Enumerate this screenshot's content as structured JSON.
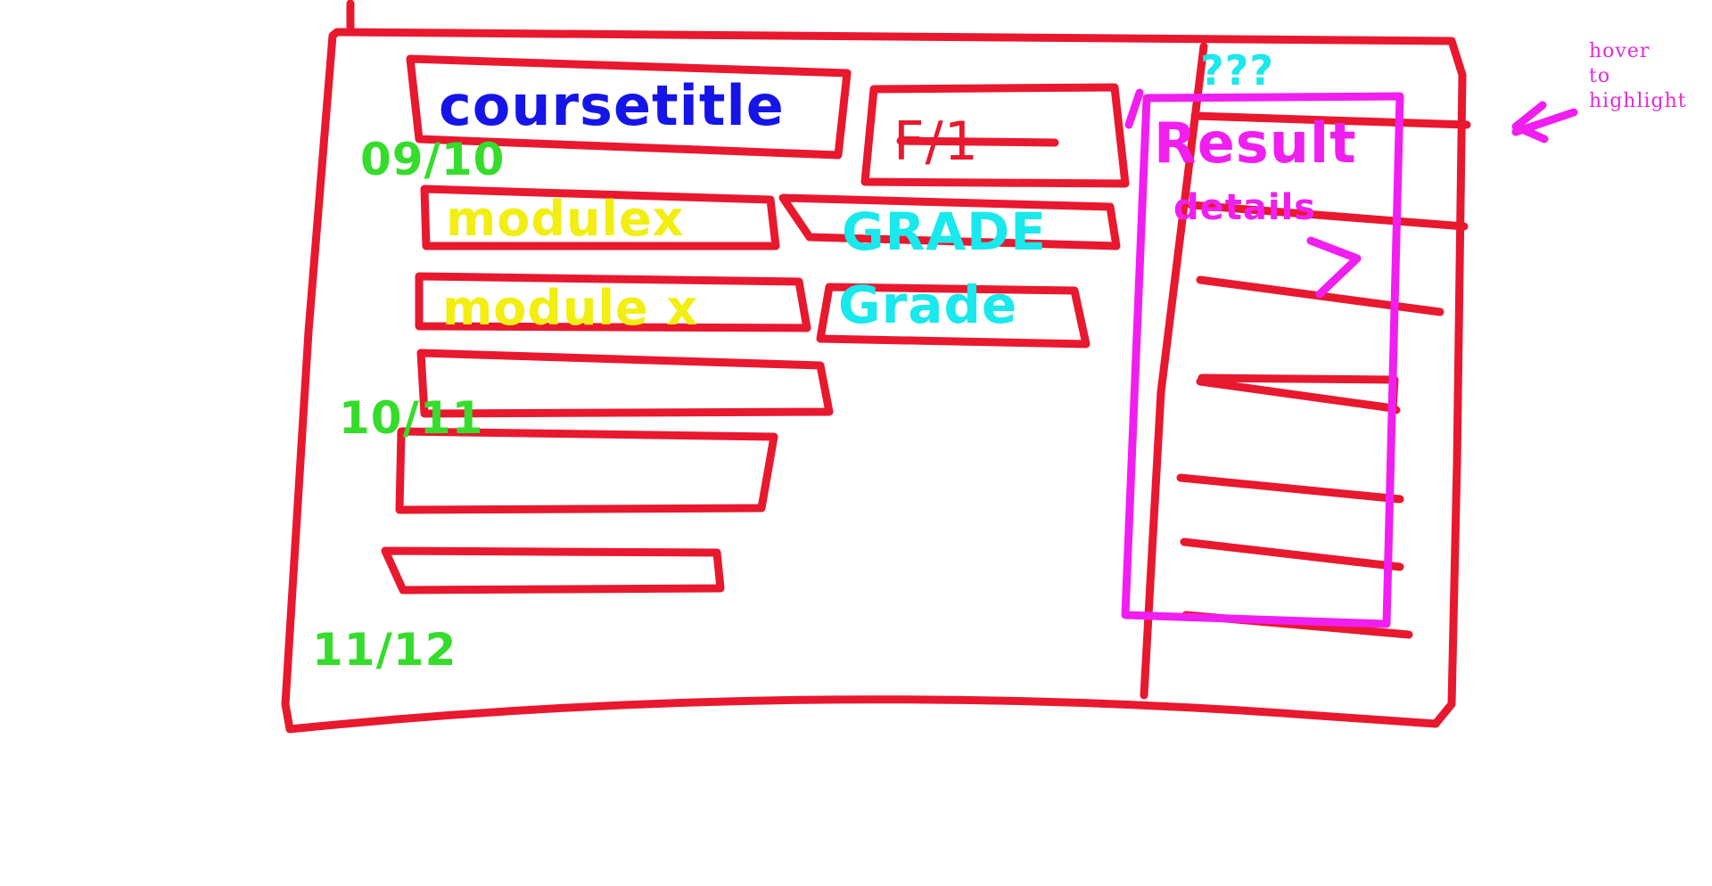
{
  "header": {
    "course_title": "coursetitle",
    "score": "F/1"
  },
  "modules": [
    {
      "label": "modulex",
      "grade": "GRADE"
    },
    {
      "label": "module x",
      "grade": "Grade"
    }
  ],
  "dates": [
    "09/10",
    "10/11",
    "11/12"
  ],
  "results_panel": {
    "top_label": "???",
    "title": "Result",
    "subtitle": "details"
  },
  "annotation": {
    "lines": [
      "hover",
      "to",
      "highlight"
    ]
  },
  "colors": {
    "outline": "#e8182e",
    "title": "#1515e8",
    "module": "#f2ee12",
    "grade": "#19e8ec",
    "date": "#35dc2c",
    "highlight": "#f01ff0"
  }
}
